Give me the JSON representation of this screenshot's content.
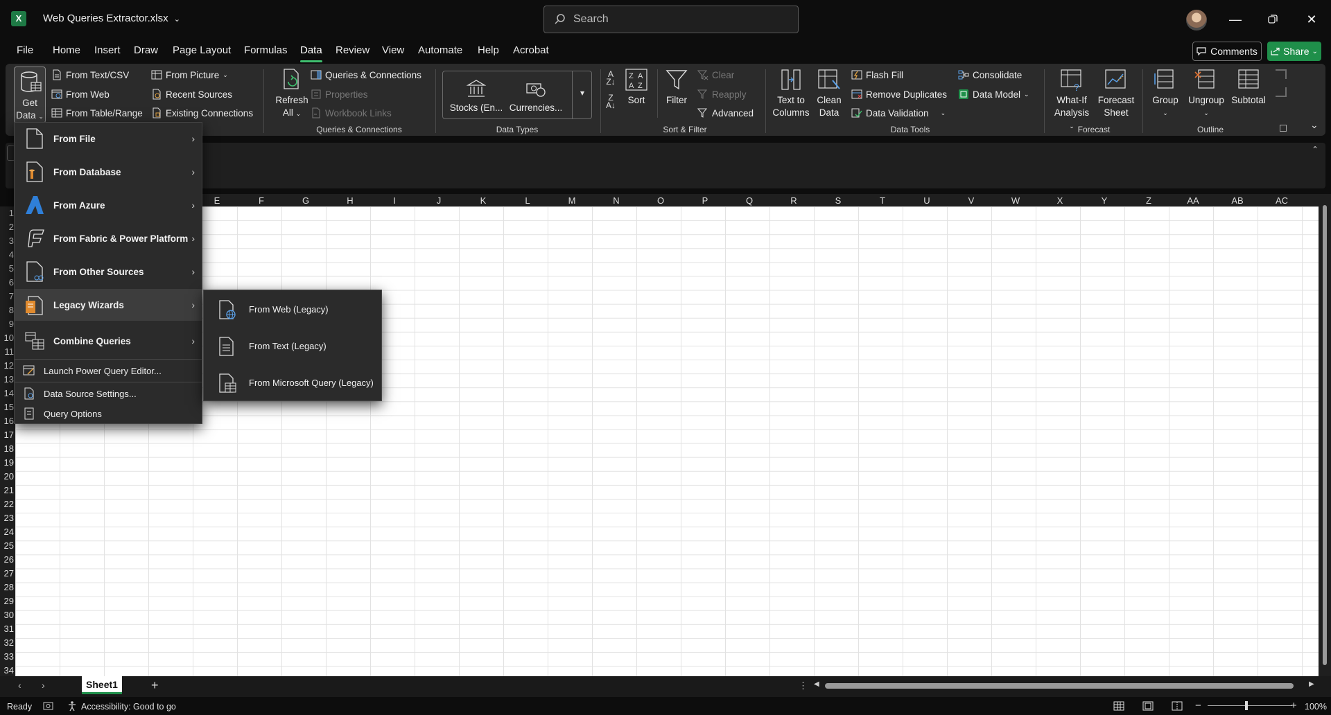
{
  "window": {
    "title": "Web Queries Extractor.xlsx",
    "search_placeholder": "Search",
    "app_icon_letter": "X"
  },
  "tabs": [
    "File",
    "Home",
    "Insert",
    "Draw",
    "Page Layout",
    "Formulas",
    "Data",
    "Review",
    "View",
    "Automate",
    "Help",
    "Acrobat"
  ],
  "active_tab": "Data",
  "header_buttons": {
    "comments": "Comments",
    "share": "Share"
  },
  "ribbon": {
    "get_data": {
      "line1": "Get",
      "line2": "Data"
    },
    "get_transform": {
      "from_text_csv": "From Text/CSV",
      "from_web": "From Web",
      "from_table_range": "From Table/Range",
      "from_picture": "From Picture",
      "recent_sources": "Recent Sources",
      "existing_connections": "Existing Connections"
    },
    "queries": {
      "refresh_line1": "Refresh",
      "refresh_line2": "All",
      "queries_connections": "Queries & Connections",
      "properties": "Properties",
      "workbook_links": "Workbook Links",
      "label": "Queries & Connections"
    },
    "data_types": {
      "stocks": "Stocks (En...",
      "currencies": "Currencies...",
      "label": "Data Types"
    },
    "sort_filter": {
      "sort": "Sort",
      "filter": "Filter",
      "clear": "Clear",
      "reapply": "Reapply",
      "advanced": "Advanced",
      "label": "Sort & Filter"
    },
    "data_tools": {
      "text_to_columns_line1": "Text to",
      "text_to_columns_line2": "Columns",
      "clean_data_line1": "Clean",
      "clean_data_line2": "Data",
      "flash_fill": "Flash Fill",
      "remove_duplicates": "Remove Duplicates",
      "data_validation": "Data Validation",
      "consolidate": "Consolidate",
      "data_model": "Data Model",
      "label": "Data Tools"
    },
    "forecast": {
      "what_if_line1": "What-If",
      "what_if_line2": "Analysis",
      "forecast_sheet_line1": "Forecast",
      "forecast_sheet_line2": "Sheet",
      "label": "Forecast"
    },
    "outline": {
      "group": "Group",
      "ungroup": "Ungroup",
      "subtotal": "Subtotal",
      "label": "Outline"
    }
  },
  "columns": [
    "E",
    "F",
    "G",
    "H",
    "I",
    "J",
    "K",
    "L",
    "M",
    "N",
    "O",
    "P",
    "Q",
    "R",
    "S",
    "T",
    "U",
    "V",
    "W",
    "X",
    "Y",
    "Z",
    "AA",
    "AB",
    "AC"
  ],
  "rows": [
    "1",
    "2",
    "3",
    "4",
    "5",
    "6",
    "7",
    "8",
    "9",
    "10",
    "11",
    "12",
    "13",
    "14",
    "15",
    "16",
    "17",
    "18",
    "19",
    "20",
    "21",
    "22",
    "23",
    "24",
    "25",
    "26",
    "27",
    "28",
    "29",
    "30",
    "31",
    "32",
    "33",
    "34"
  ],
  "get_data_menu": {
    "items": [
      {
        "label": "From File"
      },
      {
        "label": "From Database"
      },
      {
        "label": "From Azure"
      },
      {
        "label": "From Fabric & Power Platform"
      },
      {
        "label": "From Other Sources"
      },
      {
        "label": "Legacy Wizards"
      },
      {
        "label": "Combine Queries"
      }
    ],
    "small_items": [
      {
        "label": "Launch Power Query Editor..."
      },
      {
        "label": "Data Source Settings..."
      },
      {
        "label": "Query Options"
      }
    ]
  },
  "legacy_submenu": [
    {
      "label": "From Web (Legacy)"
    },
    {
      "label": "From Text (Legacy)"
    },
    {
      "label": "From Microsoft Query (Legacy)"
    }
  ],
  "sheet_tabs": [
    "Sheet1"
  ],
  "status": {
    "ready": "Ready",
    "accessibility": "Accessibility: Good to go",
    "zoom": "100%"
  },
  "colors": {
    "accent_green": "#1f8f4a",
    "tab_underline": "#3fbf6f",
    "azure_blue": "#2f7fd8",
    "legacy_orange": "#e08a2e"
  }
}
